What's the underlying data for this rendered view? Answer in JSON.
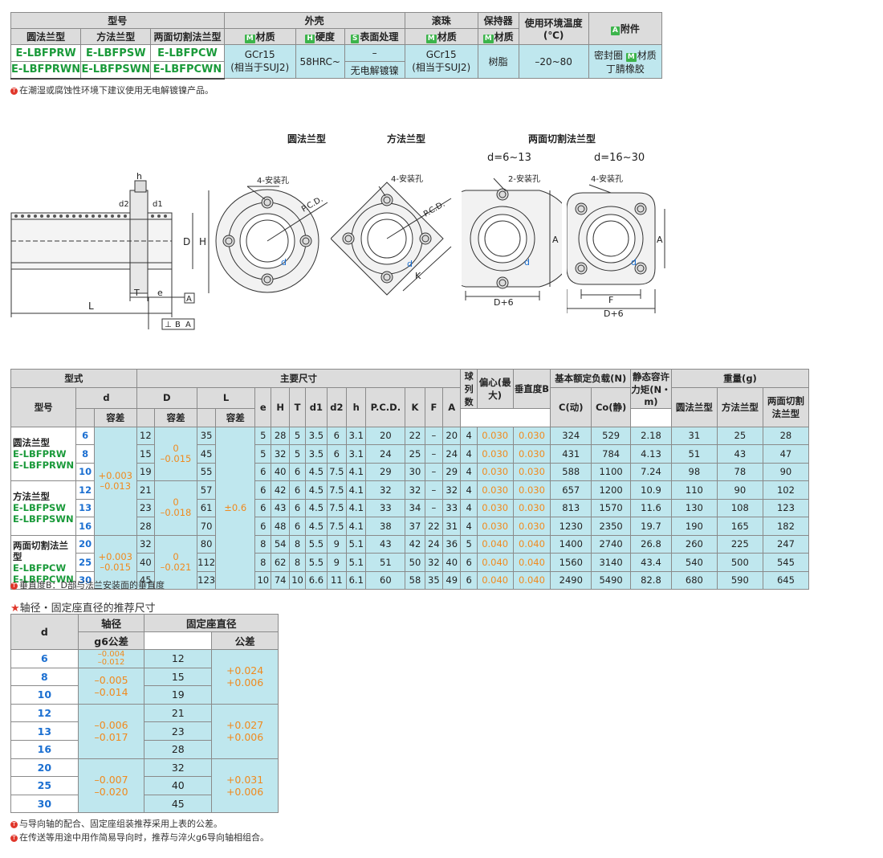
{
  "spec_table": {
    "header": {
      "model": "型号",
      "housing": "外壳",
      "balls": "滚珠",
      "retainer": "保持器",
      "temp": "使用环境温度",
      "temp_unit": "(℃)",
      "accessory": "附件",
      "accessory_badge": "A",
      "round": "圆法兰型",
      "square": "方法兰型",
      "cut": "两面切割法兰型",
      "mat_badge": "M",
      "material": "材质",
      "hard_badge": "H",
      "hardness": "硬度",
      "surf_badge": "S",
      "surface": "表面处理"
    },
    "row1": {
      "round": "E-LBFPRW",
      "square": "E-LBFPSW",
      "cut": "E-LBFPCW"
    },
    "row2": {
      "round": "E-LBFPRWN",
      "square": "E-LBFPSWN",
      "cut": "E-LBFPCWN"
    },
    "housing_material_1": "GCr15",
    "housing_material_2": "(相当于SUJ2)",
    "hardness": "58HRC~",
    "surface_1": "–",
    "surface_2": "无电解镀镍",
    "ball_material_1": "GCr15",
    "ball_material_2": "(相当于SUJ2)",
    "retainer_material": "树脂",
    "temp_range": "–20~80",
    "acc_1": "密封圈",
    "acc_1b": "材质",
    "acc_2": "丁腈橡胶"
  },
  "note1": "在潮湿或腐蚀性环境下建议使用无电解镀镍产品。",
  "diagram": {
    "title_round": "圆法兰型",
    "title_square": "方法兰型",
    "title_cut": "两面切割法兰型",
    "sub_small": "d=6~13",
    "sub_large": "d=16~30",
    "label_4holes": "4-安装孔",
    "label_2holes": "2-安装孔",
    "pcd": "P.C.D.",
    "d": "d",
    "h": "h",
    "d1": "d1",
    "d2": "d2",
    "D": "D",
    "H": "H",
    "L": "L",
    "T": "T",
    "e": "e",
    "A": "A",
    "K": "K",
    "F": "F",
    "D6": "D+6",
    "perp": "⊥",
    "B": "B"
  },
  "dim_table": {
    "h_type": "型式",
    "h_main": "主要尺寸",
    "h_ball": "球列数",
    "h_ecc": "偏心(最大)",
    "h_perp": "垂直度B",
    "h_load": "基本额定负载(N)",
    "h_moment": "静态容许力矩(N・m)",
    "h_weight": "重量(g)",
    "h_model": "型号",
    "h_d": "d",
    "h_tol": "容差",
    "h_D": "D",
    "h_L": "L",
    "h_e": "e",
    "h_H": "H",
    "h_T": "T",
    "h_d1": "d1",
    "h_d2": "d2",
    "h_h": "h",
    "h_pcd": "P.C.D.",
    "h_K": "K",
    "h_F": "F",
    "h_A": "A",
    "h_C": "C(动)",
    "h_C0": "Co(静)",
    "h_w_round": "圆法兰型",
    "h_w_square": "方法兰型",
    "h_w_cut": "两面切割法兰型",
    "groups": [
      {
        "name": "圆法兰型",
        "m1": "E-LBFPRW",
        "m2": "E-LBFPRWN"
      },
      {
        "name": "方法兰型",
        "m1": "E-LBFPSW",
        "m2": "E-LBFPSWN"
      },
      {
        "name": "两面切割法兰型",
        "m1": "E-LBFPCW",
        "m2": "E-LBFPCWN"
      }
    ],
    "d_tol_a": "+0.003",
    "d_tol_b": "–0.013",
    "d_tol_c": "+0.003",
    "d_tol_d": "–0.015",
    "D_tol_a1": "0",
    "D_tol_a2": "–0.015",
    "D_tol_b1": "0",
    "D_tol_b2": "–0.018",
    "D_tol_c1": "0",
    "D_tol_c2": "–0.021",
    "L_tol": "±0.6",
    "rows": [
      {
        "d": "6",
        "D": "12",
        "L": "35",
        "e": "5",
        "H": "28",
        "T": "5",
        "d1": "3.5",
        "d2": "6",
        "h": "3.1",
        "pcd": "20",
        "K": "22",
        "F": "–",
        "A": "20",
        "n": "4",
        "ecc": "0.030",
        "B": "0.030",
        "C": "324",
        "C0": "529",
        "M": "2.18",
        "wr": "31",
        "ws": "25",
        "wc": "28"
      },
      {
        "d": "8",
        "D": "15",
        "L": "45",
        "e": "5",
        "H": "32",
        "T": "5",
        "d1": "3.5",
        "d2": "6",
        "h": "3.1",
        "pcd": "24",
        "K": "25",
        "F": "–",
        "A": "24",
        "n": "4",
        "ecc": "0.030",
        "B": "0.030",
        "C": "431",
        "C0": "784",
        "M": "4.13",
        "wr": "51",
        "ws": "43",
        "wc": "47"
      },
      {
        "d": "10",
        "D": "19",
        "L": "55",
        "e": "6",
        "H": "40",
        "T": "6",
        "d1": "4.5",
        "d2": "7.5",
        "h": "4.1",
        "pcd": "29",
        "K": "30",
        "F": "–",
        "A": "29",
        "n": "4",
        "ecc": "0.030",
        "B": "0.030",
        "C": "588",
        "C0": "1100",
        "M": "7.24",
        "wr": "98",
        "ws": "78",
        "wc": "90"
      },
      {
        "d": "12",
        "D": "21",
        "L": "57",
        "e": "6",
        "H": "42",
        "T": "6",
        "d1": "4.5",
        "d2": "7.5",
        "h": "4.1",
        "pcd": "32",
        "K": "32",
        "F": "–",
        "A": "32",
        "n": "4",
        "ecc": "0.030",
        "B": "0.030",
        "C": "657",
        "C0": "1200",
        "M": "10.9",
        "wr": "110",
        "ws": "90",
        "wc": "102"
      },
      {
        "d": "13",
        "D": "23",
        "L": "61",
        "e": "6",
        "H": "43",
        "T": "6",
        "d1": "4.5",
        "d2": "7.5",
        "h": "4.1",
        "pcd": "33",
        "K": "34",
        "F": "–",
        "A": "33",
        "n": "4",
        "ecc": "0.030",
        "B": "0.030",
        "C": "813",
        "C0": "1570",
        "M": "11.6",
        "wr": "130",
        "ws": "108",
        "wc": "123"
      },
      {
        "d": "16",
        "D": "28",
        "L": "70",
        "e": "6",
        "H": "48",
        "T": "6",
        "d1": "4.5",
        "d2": "7.5",
        "h": "4.1",
        "pcd": "38",
        "K": "37",
        "F": "22",
        "A": "31",
        "n": "4",
        "ecc": "0.030",
        "B": "0.030",
        "C": "1230",
        "C0": "2350",
        "M": "19.7",
        "wr": "190",
        "ws": "165",
        "wc": "182"
      },
      {
        "d": "20",
        "D": "32",
        "L": "80",
        "e": "8",
        "H": "54",
        "T": "8",
        "d1": "5.5",
        "d2": "9",
        "h": "5.1",
        "pcd": "43",
        "K": "42",
        "F": "24",
        "A": "36",
        "n": "5",
        "ecc": "0.040",
        "B": "0.040",
        "C": "1400",
        "C0": "2740",
        "M": "26.8",
        "wr": "260",
        "ws": "225",
        "wc": "247"
      },
      {
        "d": "25",
        "D": "40",
        "L": "112",
        "e": "8",
        "H": "62",
        "T": "8",
        "d1": "5.5",
        "d2": "9",
        "h": "5.1",
        "pcd": "51",
        "K": "50",
        "F": "32",
        "A": "40",
        "n": "6",
        "ecc": "0.040",
        "B": "0.040",
        "C": "1560",
        "C0": "3140",
        "M": "43.4",
        "wr": "540",
        "ws": "500",
        "wc": "545"
      },
      {
        "d": "30",
        "D": "45",
        "L": "123",
        "e": "10",
        "H": "74",
        "T": "10",
        "d1": "6.6",
        "d2": "11",
        "h": "6.1",
        "pcd": "60",
        "K": "58",
        "F": "35",
        "A": "49",
        "n": "6",
        "ecc": "0.040",
        "B": "0.040",
        "C": "2490",
        "C0": "5490",
        "M": "82.8",
        "wr": "680",
        "ws": "590",
        "wc": "645"
      }
    ]
  },
  "note2": "垂直度B：D部与法兰安装面的垂直度",
  "rec_title": "轴径・固定座直径的推荐尺寸",
  "rec_table": {
    "h_d": "d",
    "h_shaft": "轴径",
    "h_g6": "g6公差",
    "h_housing": "固定座直径",
    "h_tol": "公差",
    "d_values": [
      "6",
      "8",
      "10",
      "12",
      "13",
      "16",
      "20",
      "25",
      "30"
    ],
    "g6": [
      {
        "a": "–0.004",
        "b": "–0.012"
      },
      {
        "a": "–0.005",
        "b": "–0.014"
      },
      {
        "a": "–0.006",
        "b": "–0.017"
      },
      {
        "a": "–0.007",
        "b": "–0.020"
      }
    ],
    "housing": [
      "12",
      "15",
      "19",
      "21",
      "23",
      "28",
      "32",
      "40",
      "45"
    ],
    "tol": [
      {
        "a": "+0.024",
        "b": "+0.006"
      },
      {
        "a": "+0.027",
        "b": "+0.006"
      },
      {
        "a": "+0.031",
        "b": "+0.006"
      }
    ]
  },
  "note3": "与导向轴的配合、固定座组装推荐采用上表的公差。",
  "note4": "在传送等用途中用作简易导向时，推荐与淬火g6导向轴相组合。",
  "note_icon": "T"
}
